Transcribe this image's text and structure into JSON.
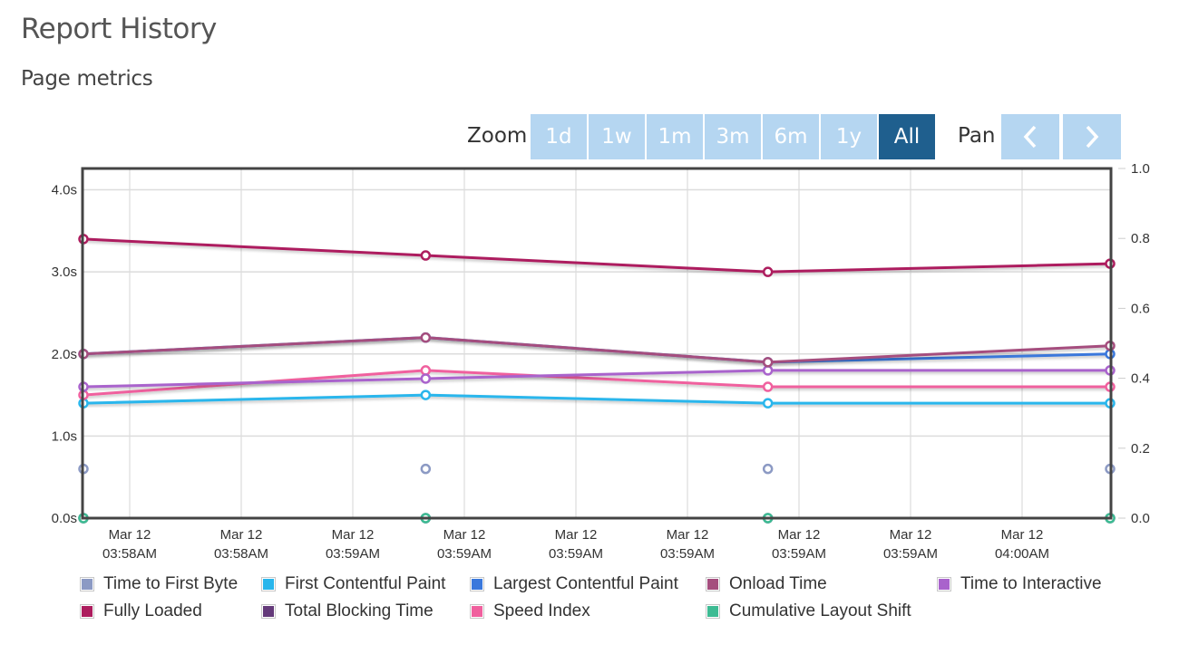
{
  "header": {
    "title": "Report History",
    "subtitle": "Page metrics"
  },
  "range_selector": {
    "zoom_label": "Zoom",
    "buttons": [
      "1d",
      "1w",
      "1m",
      "3m",
      "6m",
      "1y",
      "All"
    ],
    "active": "All",
    "pan_label": "Pan",
    "pan_prev_icon": "chevron-left-icon",
    "pan_next_icon": "chevron-right-icon"
  },
  "colors": {
    "range_button": "#b5d6f1",
    "range_button_active": "#1f5f8e"
  },
  "chart_data": {
    "type": "line",
    "title": "Page metrics",
    "xlabel": "",
    "ylabel": "",
    "x_tick_labels": [
      [
        "Mar 12",
        "03:58AM"
      ],
      [
        "Mar 12",
        "03:58AM"
      ],
      [
        "Mar 12",
        "03:59AM"
      ],
      [
        "Mar 12",
        "03:59AM"
      ],
      [
        "Mar 12",
        "03:59AM"
      ],
      [
        "Mar 12",
        "03:59AM"
      ],
      [
        "Mar 12",
        "03:59AM"
      ],
      [
        "Mar 12",
        "03:59AM"
      ],
      [
        "Mar 12",
        "04:00AM"
      ]
    ],
    "x_points": [
      0,
      1,
      2,
      3
    ],
    "y_left": {
      "ticks": [
        0,
        1,
        2,
        3,
        4
      ],
      "tick_labels": [
        "0.0s",
        "1.0s",
        "2.0s",
        "3.0s",
        "4.0s"
      ],
      "range": [
        0,
        4.26
      ]
    },
    "y_right": {
      "ticks": [
        0,
        0.2,
        0.4,
        0.6,
        0.8,
        1.0
      ],
      "tick_labels": [
        "0.0",
        "0.2",
        "0.4",
        "0.6",
        "0.8",
        "1.0"
      ],
      "range": [
        0,
        1.0
      ]
    },
    "grid": true,
    "legend_position": "bottom",
    "series": [
      {
        "name": "Time to First Byte",
        "color": "#8c9ac4",
        "axis": "left",
        "values": [
          0.6,
          0.6,
          0.6,
          0.6
        ]
      },
      {
        "name": "First Contentful Paint",
        "color": "#29b6ec",
        "axis": "left",
        "values": [
          1.4,
          1.5,
          1.4,
          1.4
        ]
      },
      {
        "name": "Largest Contentful Paint",
        "color": "#3a78dc",
        "axis": "left",
        "values": [
          2.0,
          2.2,
          1.9,
          2.0
        ]
      },
      {
        "name": "Onload Time",
        "color": "#a54e7e",
        "axis": "left",
        "values": [
          2.0,
          2.2,
          1.9,
          2.1
        ]
      },
      {
        "name": "Time to Interactive",
        "color": "#a963cc",
        "axis": "left",
        "values": [
          1.6,
          1.7,
          1.8,
          1.8
        ]
      },
      {
        "name": "Fully Loaded",
        "color": "#ad1d5e",
        "axis": "left",
        "values": [
          3.4,
          3.2,
          3.0,
          3.1
        ]
      },
      {
        "name": "Total Blocking Time",
        "color": "#643a7a",
        "axis": "left",
        "values": [
          0,
          0,
          0,
          0
        ]
      },
      {
        "name": "Speed Index",
        "color": "#f0609e",
        "axis": "left",
        "values": [
          1.5,
          1.8,
          1.6,
          1.6
        ]
      },
      {
        "name": "Cumulative Layout Shift",
        "color": "#3dbb93",
        "axis": "right",
        "values": [
          0,
          0,
          0,
          0
        ]
      }
    ]
  }
}
